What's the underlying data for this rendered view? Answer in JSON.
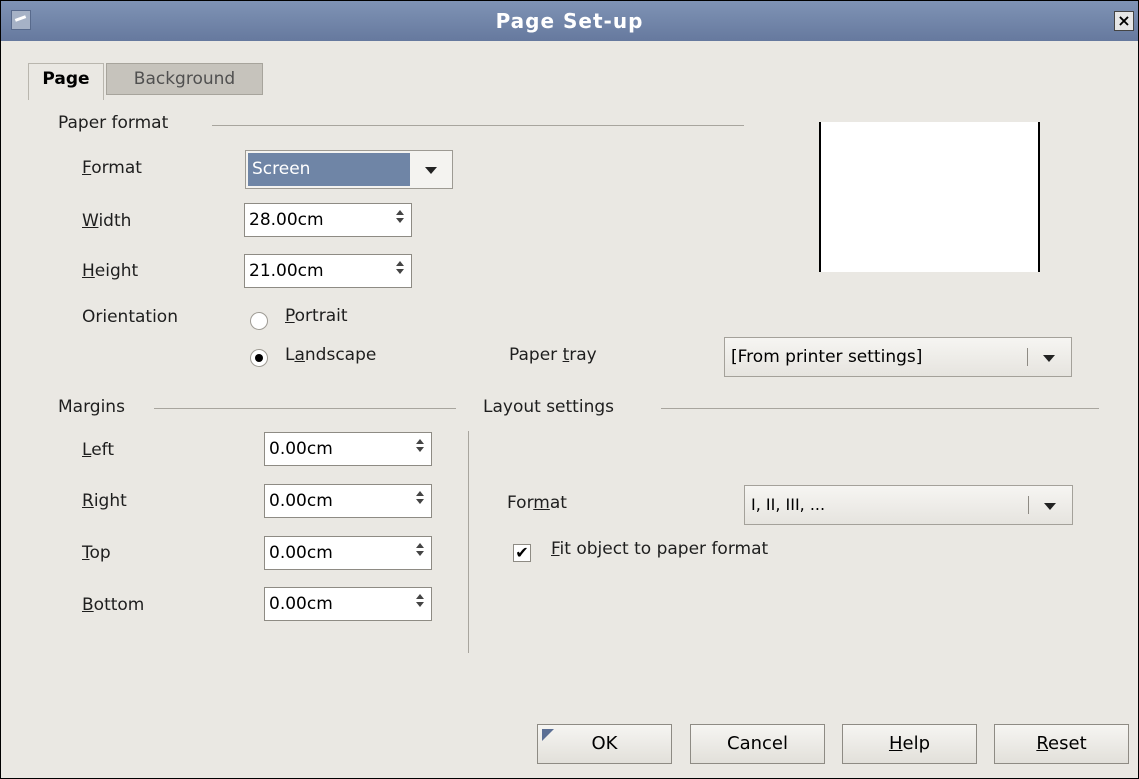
{
  "window": {
    "title": "Page Set-up"
  },
  "tabs": [
    {
      "label": "Page"
    },
    {
      "label": "Background"
    }
  ],
  "paper_format": {
    "section_label": "Paper format",
    "format_label": "Format",
    "format_value": "Screen",
    "width_label": "Width",
    "width_value": "28.00cm",
    "height_label": "Height",
    "height_value": "21.00cm",
    "orientation_label": "Orientation",
    "portrait_label": "Portrait",
    "landscape_label": "Landscape",
    "orientation_selected": "Landscape",
    "paper_tray_label": "Paper tray",
    "paper_tray_value": "[From printer settings]"
  },
  "margins": {
    "section_label": "Margins",
    "left_label": "Left",
    "left_value": "0.00cm",
    "right_label": "Right",
    "right_value": "0.00cm",
    "top_label": "Top",
    "top_value": "0.00cm",
    "bottom_label": "Bottom",
    "bottom_value": "0.00cm"
  },
  "layout": {
    "section_label": "Layout settings",
    "format_label": "Format",
    "format_value": "I, II, III, ...",
    "fit_label": "Fit object to paper format",
    "fit_checked": true
  },
  "buttons": {
    "ok": "OK",
    "cancel": "Cancel",
    "help": "Help",
    "reset": "Reset"
  },
  "colors": {
    "titlebar": "#7183a6",
    "dialog_bg": "#eae8e3",
    "selection": "#6f85a6"
  }
}
